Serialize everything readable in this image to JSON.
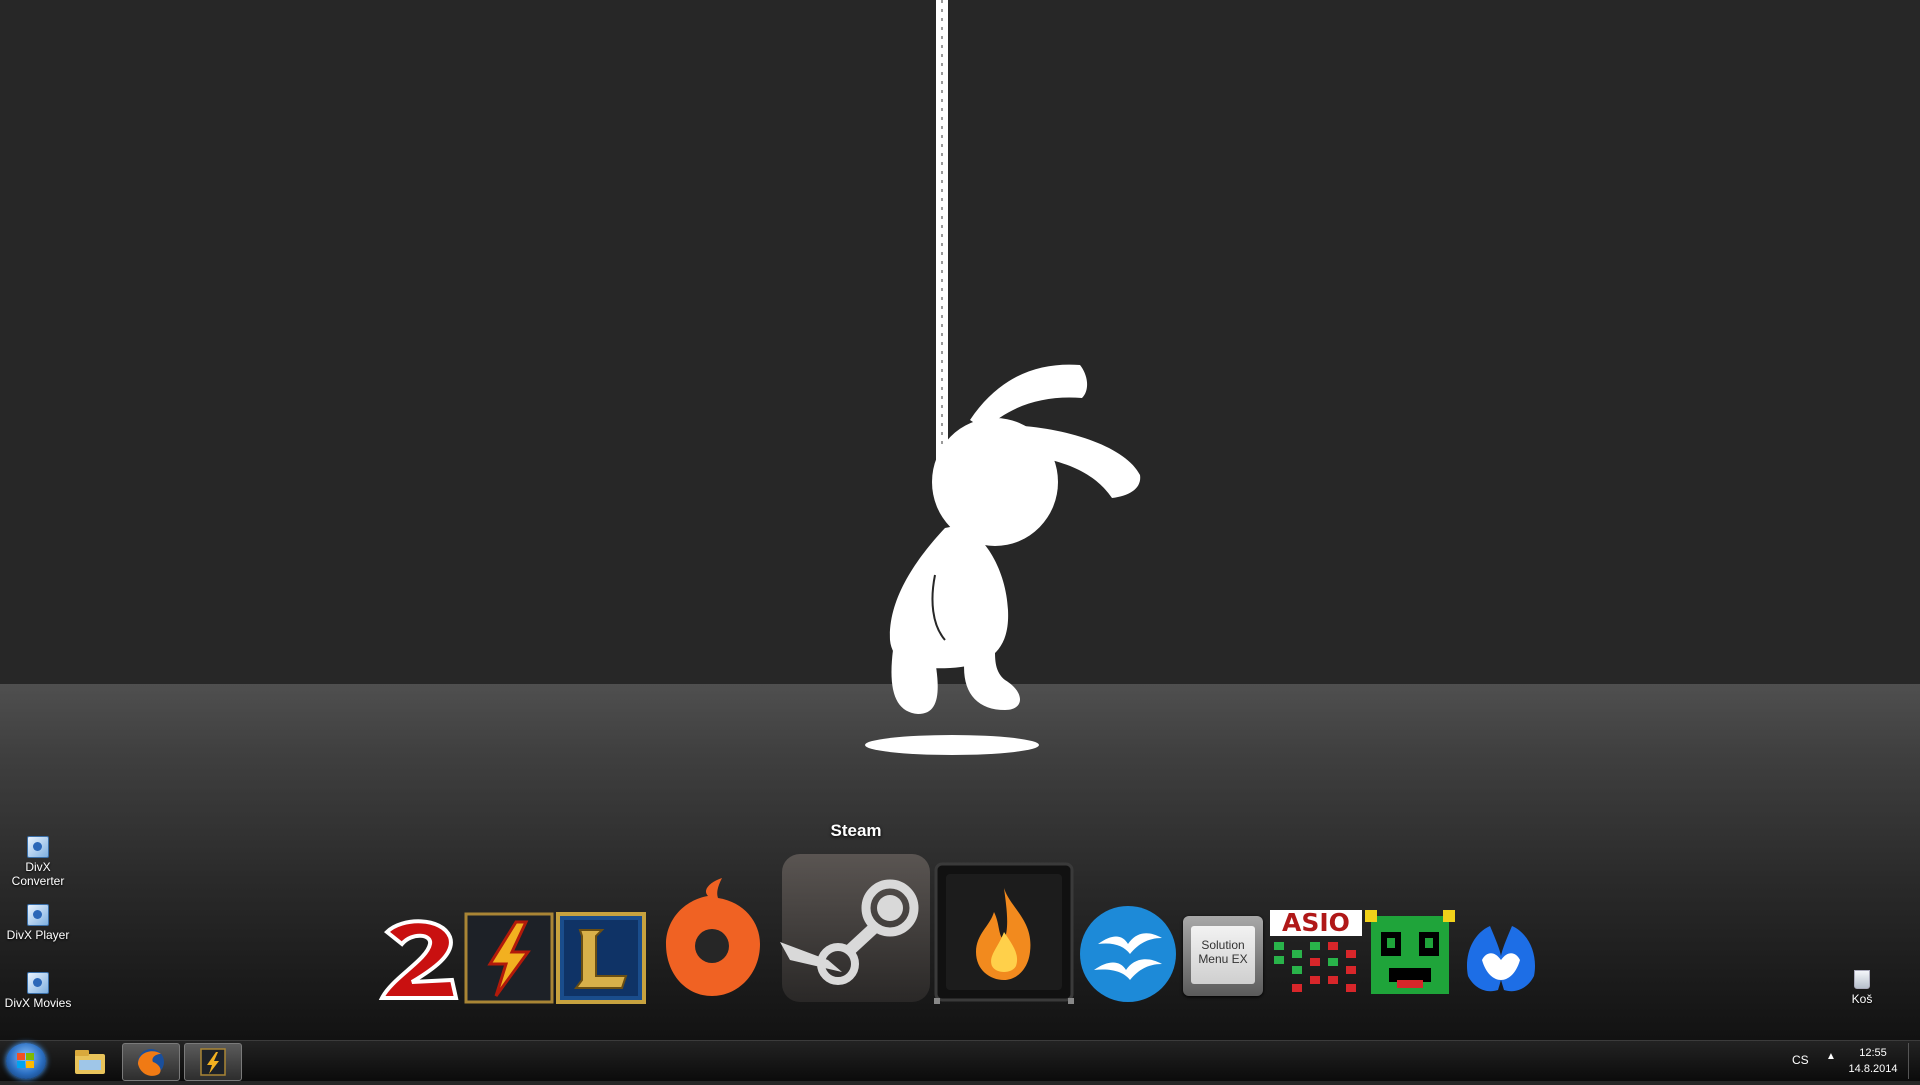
{
  "desktop": {
    "icons": [
      {
        "label": "DivX Converter"
      },
      {
        "label": "DivX Player"
      },
      {
        "label": "DivX Movies"
      }
    ],
    "recycle_bin": {
      "label": "Koš"
    }
  },
  "dock": {
    "hover_label": "Steam",
    "items": [
      {
        "icon": "guild-wars-2-icon"
      },
      {
        "icon": "lol-launcher-icon"
      },
      {
        "icon": "league-of-legends-icon"
      },
      {
        "icon": "origin-icon"
      },
      {
        "icon": "steam-icon"
      },
      {
        "icon": "flame-app-icon"
      },
      {
        "icon": "openoffice-icon"
      },
      {
        "label": "Solution Menu EX",
        "line1": "Solution",
        "line2": "Menu EX"
      },
      {
        "label": "ASIO",
        "icon": "asio-icon"
      },
      {
        "icon": "pixel-creature-icon"
      },
      {
        "icon": "malwarebytes-icon"
      }
    ]
  },
  "taskbar": {
    "language": "CS",
    "time": "12:55",
    "date": "14.8.2014",
    "pinned": [
      "windows-explorer-icon",
      "firefox-icon",
      "lol-launcher-icon"
    ]
  },
  "colors": {
    "wall": "#272727",
    "floor": "#4f4f4f",
    "origin": "#f06223",
    "openoffice": "#1d8ad8",
    "malwarebytes": "#1d6ee6"
  }
}
